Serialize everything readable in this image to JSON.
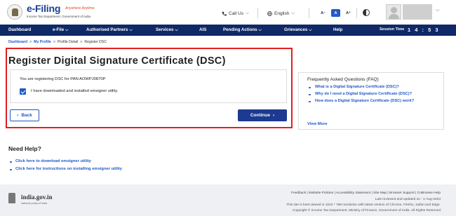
{
  "header": {
    "logo_title": "e-Filing",
    "logo_tagline": "Anywhere Anytime",
    "logo_subtitle": "Income Tax Department, Government of India",
    "call_us": "Call Us",
    "language": "English",
    "font_small": "A⁻",
    "font_normal": "A",
    "font_large": "A⁺"
  },
  "nav": {
    "items": [
      "Dashboard",
      "e-File",
      "Authorised Partners",
      "Services",
      "AIS",
      "Pending Actions",
      "Grievances",
      "Help"
    ],
    "session_label": "Session Time",
    "session_time": "1 4 : 5 3"
  },
  "breadcrumb": {
    "items": [
      "Dashboard",
      "My Profile",
      "Profile Detail",
      "Register DSC"
    ],
    "separator": ">"
  },
  "main": {
    "title": "Register Digital Signature Certificate (DSC)",
    "pan_text": "You are registering DSC for PAN AOWPJ0870P",
    "checkbox_label": "I have downloaded and installed emsigner utility.",
    "back_label": "Back",
    "continue_label": "Continue"
  },
  "faq": {
    "title": "Frequently Asked Questions (FAQ)",
    "items": [
      "What is a Digital Signature Certificate (DSC)?",
      "Why do I need a Digital Signature Certificate (DSC)?",
      "How does a Digital Signature Certificate (DSC) work?"
    ],
    "view_more": "View More"
  },
  "help": {
    "title": "Need Help?",
    "items": [
      "Click here to download emsigner utility",
      "Click here for instructions on installing emsigner utility"
    ]
  },
  "footer": {
    "india_name": "india.gov.in",
    "india_sub": "national portal of india",
    "links": [
      "Feedback",
      "Website Policies",
      "Accessibility Statement",
      "Site Map",
      "Browser Support",
      "CoBrowse Help"
    ],
    "line1": "Last reviewed and updated on : 1-Aug-2023",
    "line2": "This site is best viewed in 1024 * 768 resolution with latest version of Chrome, Firefox, Safari and Edge.",
    "line3": "Copyright © Income Tax Department, Ministry of Finance, Government of India. All Rights Reserved"
  },
  "colors": {
    "nav_bg": "#0f2967",
    "brand_blue": "#2159c7",
    "primary_button": "#1c3a8f",
    "highlight_border": "#e01f24",
    "tagline": "#e24a1d"
  }
}
